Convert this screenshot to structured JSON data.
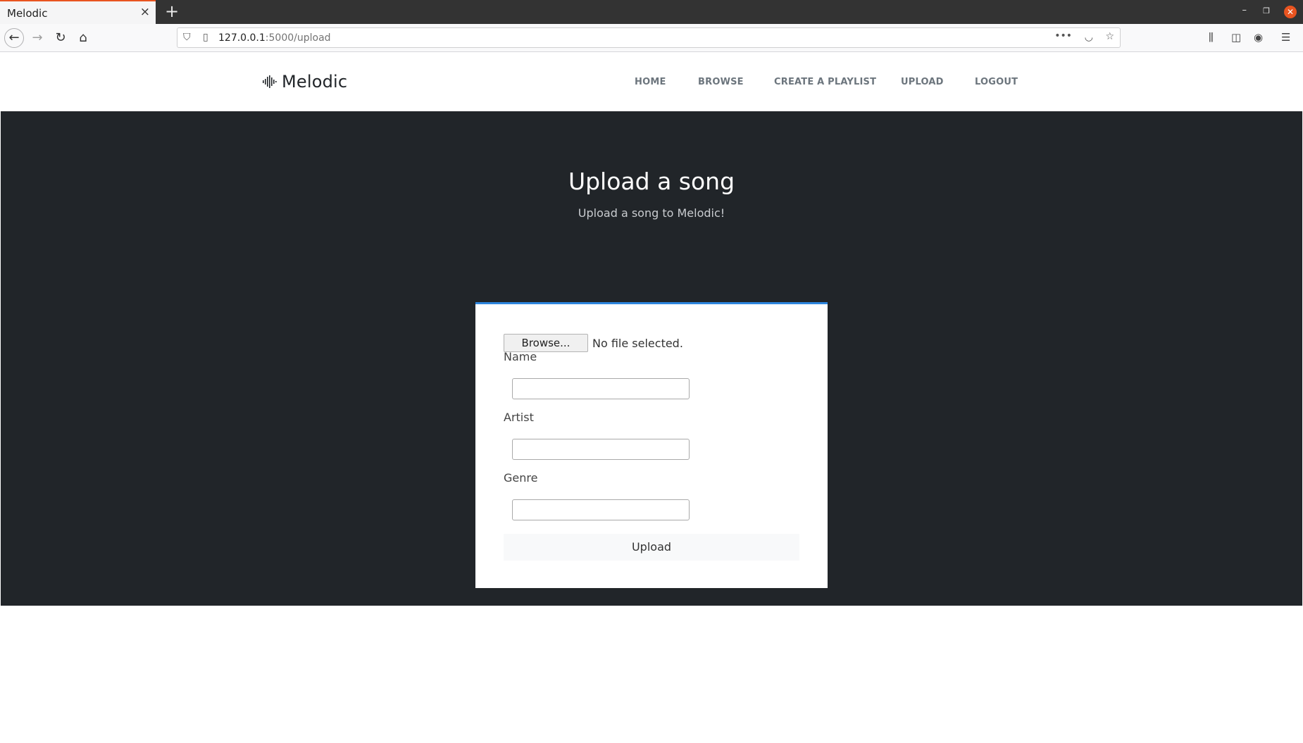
{
  "browser": {
    "tab_title": "Melodic",
    "tab_close": "×",
    "new_tab": "+",
    "url_host": "127.0.0.1",
    "url_rest": ":5000/upload",
    "accent_color": "#e95420"
  },
  "header": {
    "brand": "Melodic",
    "nav": [
      "HOME",
      "BROWSE",
      "CREATE A PLAYLIST",
      "UPLOAD",
      "LOGOUT"
    ]
  },
  "hero": {
    "title": "Upload a song",
    "subtitle": "Upload a song to Melodic!",
    "background": "#212529"
  },
  "form": {
    "browse_label": "Browse...",
    "file_status": "No file selected.",
    "fields": [
      {
        "label": "Name",
        "value": ""
      },
      {
        "label": "Artist",
        "value": ""
      },
      {
        "label": "Genre",
        "value": ""
      }
    ],
    "submit_label": "Upload",
    "accent_color": "#2e86de"
  }
}
